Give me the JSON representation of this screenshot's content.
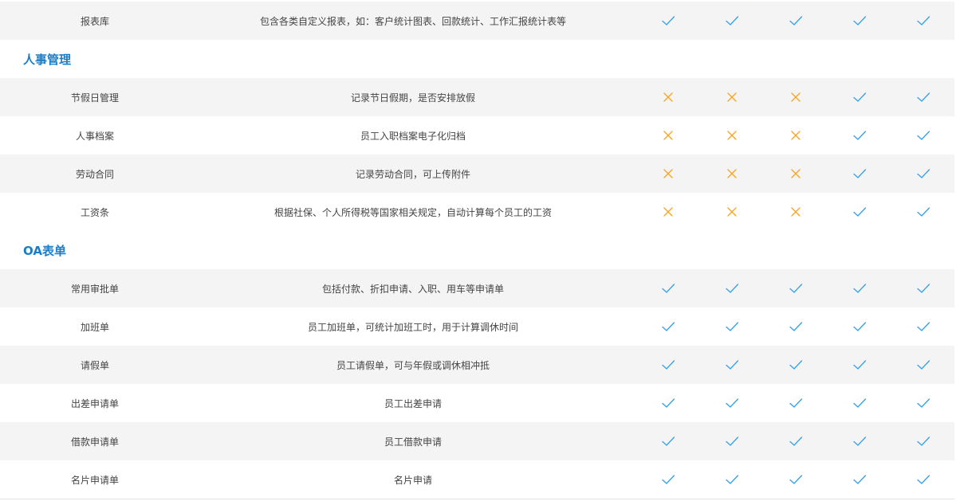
{
  "colors": {
    "check": "#3aa3ea",
    "cross": "#f5a623",
    "section_title": "#1a7dc8"
  },
  "sections": [
    {
      "title": "",
      "rows": [
        {
          "name": "报表库",
          "desc": "包含各类自定义报表，如：客户统计图表、回款统计、工作汇报统计表等",
          "marks": [
            "check",
            "check",
            "check",
            "check",
            "check"
          ]
        }
      ]
    },
    {
      "title": "人事管理",
      "rows": [
        {
          "name": "节假日管理",
          "desc": "记录节日假期，是否安排放假",
          "marks": [
            "cross",
            "cross",
            "cross",
            "check",
            "check"
          ]
        },
        {
          "name": "人事档案",
          "desc": "员工入职档案电子化归档",
          "marks": [
            "cross",
            "cross",
            "cross",
            "check",
            "check"
          ]
        },
        {
          "name": "劳动合同",
          "desc": "记录劳动合同，可上传附件",
          "marks": [
            "cross",
            "cross",
            "cross",
            "check",
            "check"
          ]
        },
        {
          "name": "工资条",
          "desc": "根据社保、个人所得税等国家相关规定，自动计算每个员工的工资",
          "marks": [
            "cross",
            "cross",
            "cross",
            "check",
            "check"
          ]
        }
      ]
    },
    {
      "title": "OA表单",
      "rows": [
        {
          "name": "常用审批单",
          "desc": "包括付款、折扣申请、入职、用车等申请单",
          "marks": [
            "check",
            "check",
            "check",
            "check",
            "check"
          ]
        },
        {
          "name": "加班单",
          "desc": "员工加班单，可统计加班工时，用于计算调休时间",
          "marks": [
            "check",
            "check",
            "check",
            "check",
            "check"
          ]
        },
        {
          "name": "请假单",
          "desc": "员工请假单，可与年假或调休相冲抵",
          "marks": [
            "check",
            "check",
            "check",
            "check",
            "check"
          ]
        },
        {
          "name": "出差申请单",
          "desc": "员工出差申请",
          "marks": [
            "check",
            "check",
            "check",
            "check",
            "check"
          ]
        },
        {
          "name": "借款申请单",
          "desc": "员工借款申请",
          "marks": [
            "check",
            "check",
            "check",
            "check",
            "check"
          ]
        },
        {
          "name": "名片申请单",
          "desc": "名片申请",
          "marks": [
            "check",
            "check",
            "check",
            "check",
            "check"
          ]
        }
      ]
    }
  ]
}
